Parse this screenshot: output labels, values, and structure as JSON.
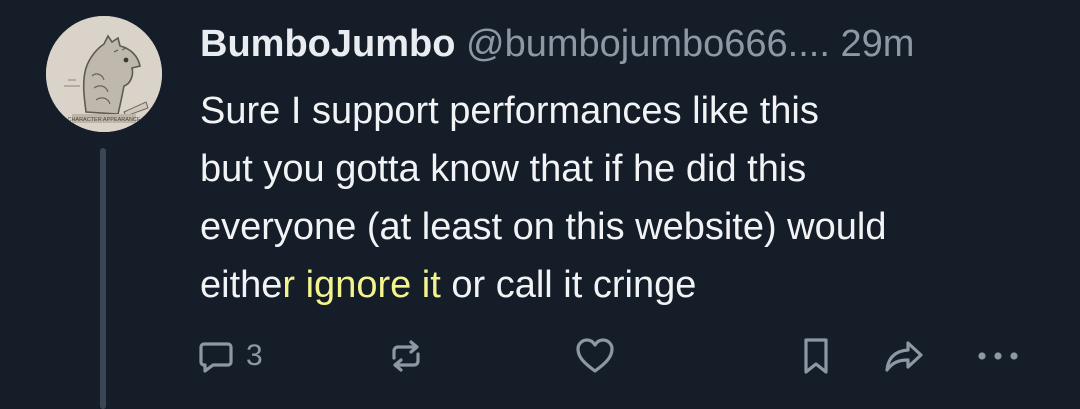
{
  "post": {
    "author": {
      "display_name": "BumboJumbo",
      "handle": "@bumbojumbo666....",
      "time": "29m",
      "avatar_caption": "CHARACTER APPEARANCE"
    },
    "text_lines": [
      {
        "before": "Sure I support performances like this",
        "highlight": "",
        "after": ""
      },
      {
        "before": "but you gotta know that if he did this",
        "highlight": "",
        "after": ""
      },
      {
        "before": "everyone (at least on this website) would",
        "highlight": "",
        "after": ""
      },
      {
        "before": "eithe",
        "highlight": "r ignore it ",
        "after": "or call it cringe"
      }
    ],
    "actions": {
      "reply_count": "3",
      "reply_icon": "speech-bubble-icon",
      "repost_icon": "repost-arrows-icon",
      "like_icon": "heart-icon",
      "bookmark_icon": "bookmark-icon",
      "share_icon": "share-arrow-icon",
      "more_icon": "ellipsis-icon"
    }
  },
  "colors": {
    "background": "#151d28",
    "text": "#f1f3f5",
    "muted": "#8d98a5",
    "highlight": "#7b7a14"
  }
}
